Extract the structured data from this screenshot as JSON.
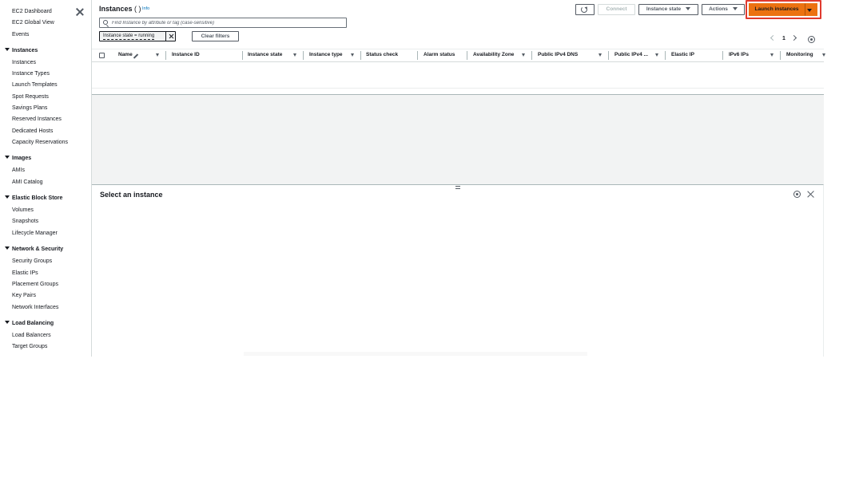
{
  "sidebar": {
    "top_links": [
      "EC2 Dashboard",
      "EC2 Global View",
      "Events"
    ],
    "sections": [
      {
        "title": "Instances",
        "items": [
          "Instances",
          "Instance Types",
          "Launch Templates",
          "Spot Requests",
          "Savings Plans",
          "Reserved Instances",
          "Dedicated Hosts",
          "Capacity Reservations"
        ]
      },
      {
        "title": "Images",
        "items": [
          "AMIs",
          "AMI Catalog"
        ]
      },
      {
        "title": "Elastic Block Store",
        "items": [
          "Volumes",
          "Snapshots",
          "Lifecycle Manager"
        ]
      },
      {
        "title": "Network & Security",
        "items": [
          "Security Groups",
          "Elastic IPs",
          "Placement Groups",
          "Key Pairs",
          "Network Interfaces"
        ]
      },
      {
        "title": "Load Balancing",
        "items": [
          "Load Balancers",
          "Target Groups"
        ]
      }
    ]
  },
  "header": {
    "title": "Instances",
    "count": "( )",
    "info": "Info"
  },
  "search": {
    "placeholder": "Find Instance by attribute or tag (case-sensitive)"
  },
  "filter": {
    "token": "Instance state = running",
    "clear_label": "Clear filters"
  },
  "toolbar": {
    "connect": "Connect",
    "instance_state": "Instance state",
    "actions": "Actions",
    "launch": "Launch instances"
  },
  "pagination": {
    "page": "1"
  },
  "table": {
    "columns": [
      "Name",
      "Instance ID",
      "Instance state",
      "Instance type",
      "Status check",
      "Alarm status",
      "Availability Zone",
      "Public IPv4 DNS",
      "Public IPv4 ...",
      "Elastic IP",
      "IPv6 IPs",
      "Monitoring"
    ]
  },
  "split_panel": {
    "title": "Select an instance"
  },
  "colors": {
    "accent_orange": "#ec7211",
    "highlight_red": "#e03a2f",
    "link_blue": "#0073bb"
  }
}
